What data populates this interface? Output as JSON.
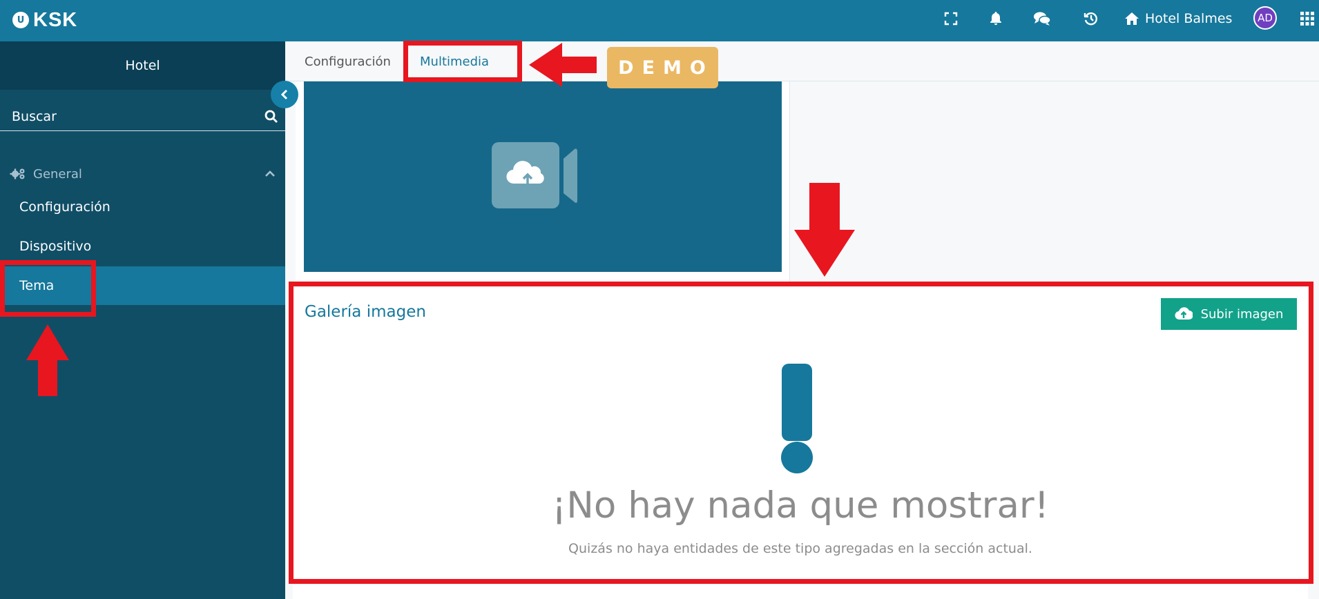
{
  "topbar": {
    "logo_mark": "U",
    "logo_text": "KSK",
    "icons": [
      "fullscreen-icon",
      "bell-icon",
      "chat-icon",
      "history-icon",
      "home-icon",
      "apps-grid-icon"
    ],
    "hotel_name": "Hotel Balmes",
    "avatar_initials": "AD"
  },
  "sidebar": {
    "header": "Hotel",
    "search_placeholder": "Buscar",
    "section": "General",
    "items": [
      {
        "label": "Configuración"
      },
      {
        "label": "Dispositivo"
      },
      {
        "label": "Tema",
        "active": true
      }
    ]
  },
  "tabs": [
    {
      "label": "Configuración"
    },
    {
      "label": "Multimedia",
      "active": true
    }
  ],
  "demo_badge": "DEMO",
  "gallery": {
    "title": "Galería imagen",
    "upload_label": "Subir imagen",
    "empty_title": "¡No hay nada que mostrar!",
    "empty_subtitle": "Quizás no haya entidades de este tipo agregadas en la sección actual."
  },
  "colors": {
    "topbar": "#16789c",
    "sidebar": "#104e66",
    "accent": "#16789c",
    "upload_button": "#12a28a",
    "annotation": "#e8161f",
    "demo": "#eab863"
  }
}
